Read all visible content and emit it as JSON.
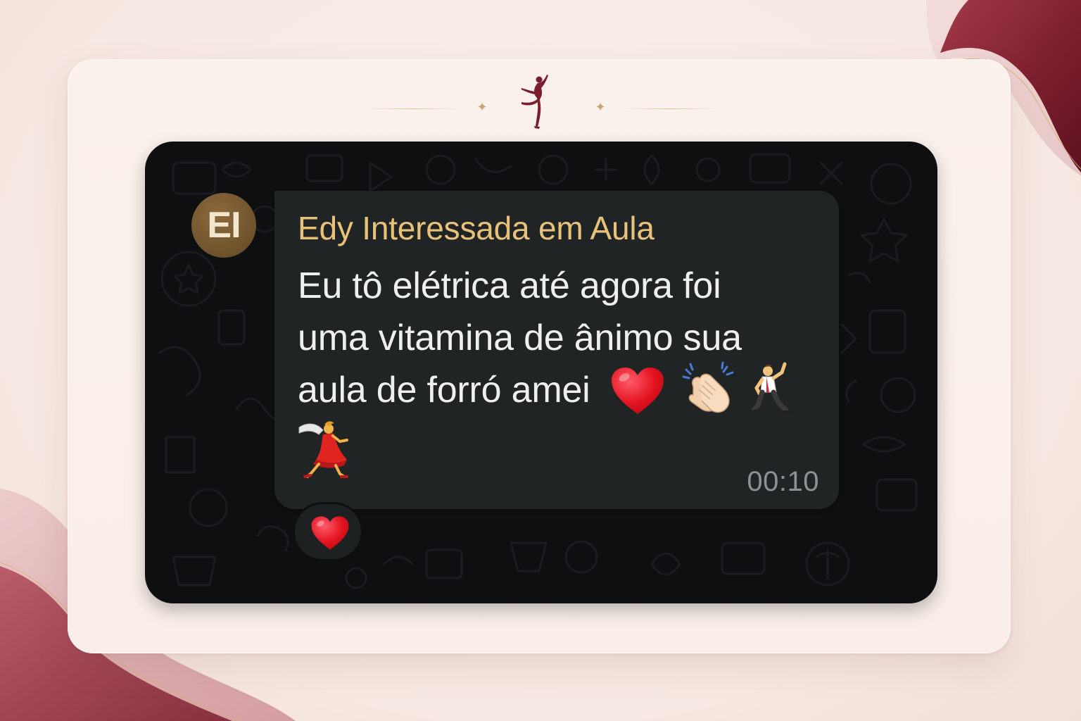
{
  "chat": {
    "avatar_initials": "EI",
    "sender_name": "Edy Interessada em Aula",
    "message_line1": "Eu tô elétrica até agora foi",
    "message_line2": "uma vitamina de ânimo sua",
    "message_line3": "aula de forró amei",
    "message_emojis": [
      "red-heart",
      "clapping-hands",
      "man-dancing",
      "woman-dancing"
    ],
    "timestamp": "00:10",
    "reaction_emoji": "red-heart"
  },
  "colors": {
    "page_background": "#f8ece6",
    "card_background": "#fbf1ec",
    "chat_background": "#0d0f10",
    "bubble_background": "#202425",
    "sender_name_color": "#e9c27a",
    "message_text_color": "#eef0f0",
    "timestamp_color": "#8c9294",
    "accent_burgundy": "#7a1d2c",
    "accent_gold": "#c9a56d"
  },
  "icons": {
    "logo": "ballerina-silhouette-icon",
    "ornament_stars": "sparkle-icon"
  }
}
